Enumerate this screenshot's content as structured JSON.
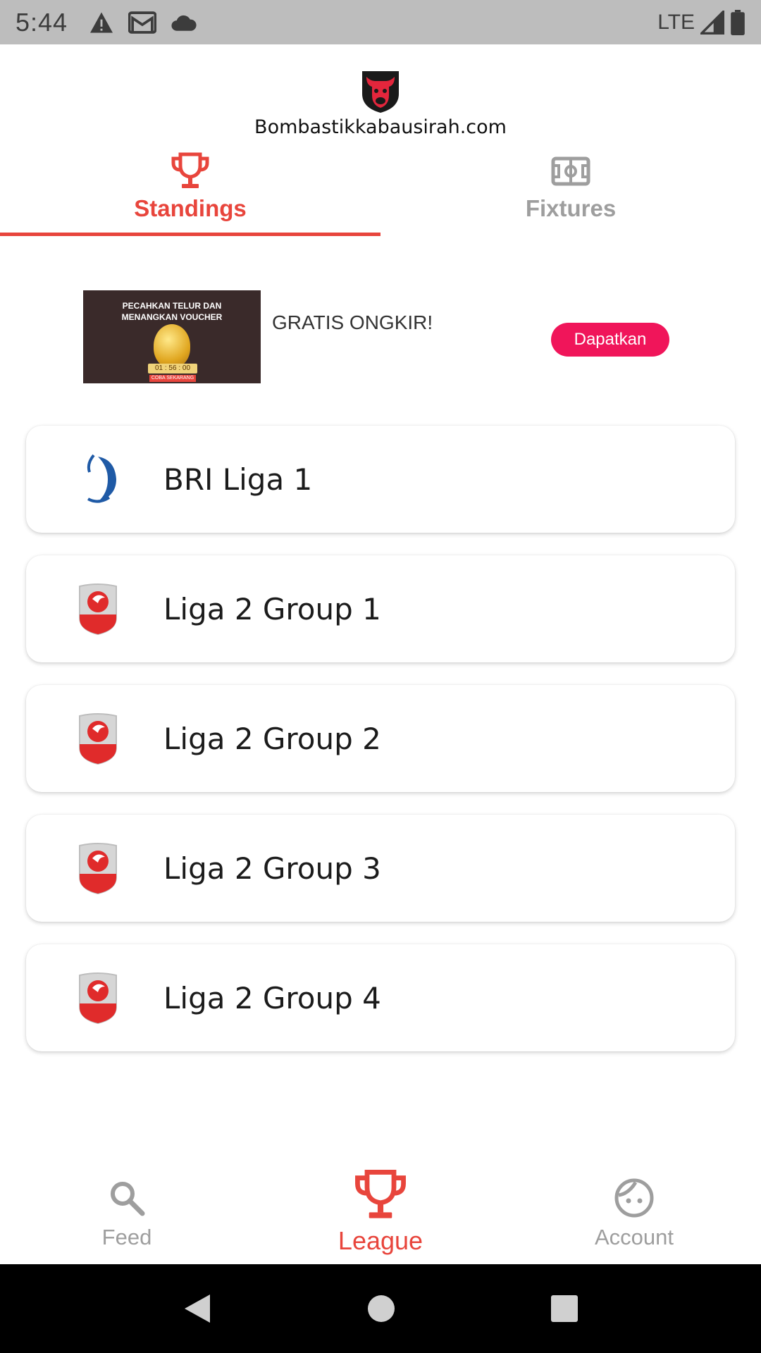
{
  "status_bar": {
    "time": "5:44",
    "network": "LTE",
    "icons": [
      "warning-icon",
      "gmail-icon",
      "cloud-icon",
      "signal-icon",
      "battery-icon"
    ]
  },
  "header": {
    "logo_icon": "bull-logo-icon",
    "site_name": "Bombastikkabausirah.com"
  },
  "tabs": [
    {
      "label": "Standings",
      "icon": "trophy-icon",
      "active": true
    },
    {
      "label": "Fixtures",
      "icon": "field-icon",
      "active": false
    }
  ],
  "ad": {
    "image_title_line1": "PECAHKAN TELUR DAN",
    "image_title_line2": "MENANGKAN VOUCHER",
    "image_timer": "01 : 56 : 00",
    "image_cta": "COBA SEKARANG",
    "headline": "GRATIS ONGKIR!",
    "button_label": "Dapatkan"
  },
  "leagues": [
    {
      "name": "BRI Liga 1",
      "logo": "bri-liga1-logo-icon"
    },
    {
      "name": "Liga 2 Group 1",
      "logo": "liga2-logo-icon"
    },
    {
      "name": "Liga 2 Group 2",
      "logo": "liga2-logo-icon"
    },
    {
      "name": "Liga 2 Group 3",
      "logo": "liga2-logo-icon"
    },
    {
      "name": "Liga 2 Group 4",
      "logo": "liga2-logo-icon"
    }
  ],
  "bottom_nav": [
    {
      "label": "Feed",
      "icon": "search-icon",
      "active": false
    },
    {
      "label": "League",
      "icon": "trophy-icon",
      "active": true
    },
    {
      "label": "Account",
      "icon": "face-icon",
      "active": false
    }
  ],
  "colors": {
    "accent": "#e8453c",
    "inactive": "#9e9e9e",
    "ad_button": "#f0155a",
    "status_bar": "#bdbdbd"
  }
}
